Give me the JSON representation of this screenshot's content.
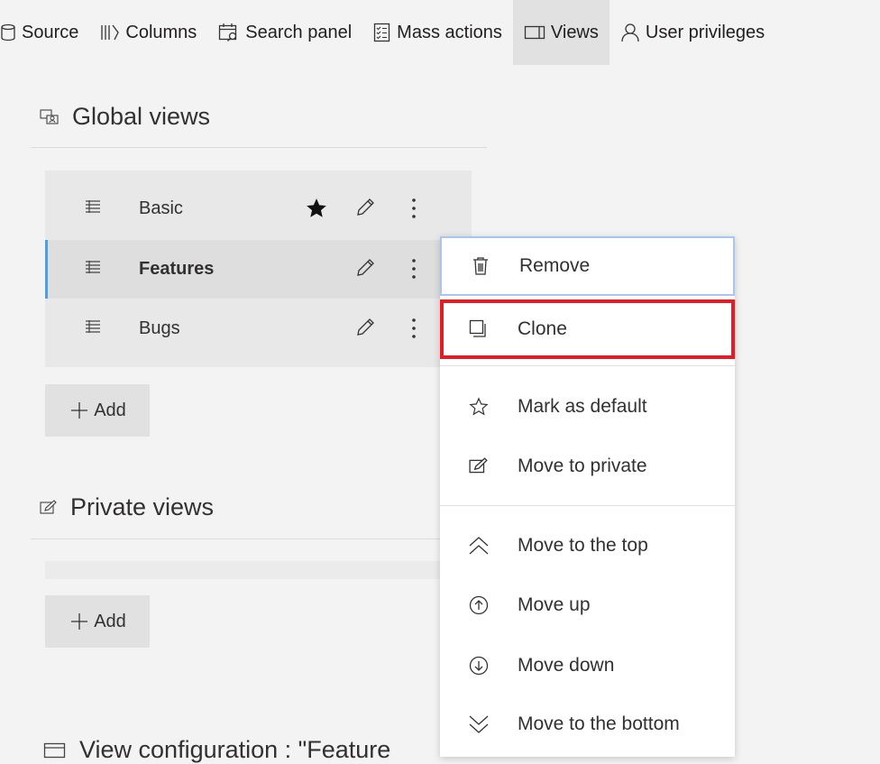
{
  "toolbar": {
    "items": [
      {
        "label": "Source",
        "icon": "database-icon"
      },
      {
        "label": "Columns",
        "icon": "columns-icon"
      },
      {
        "label": "Search panel",
        "icon": "search-panel-icon"
      },
      {
        "label": "Mass actions",
        "icon": "mass-actions-icon"
      },
      {
        "label": "Views",
        "icon": "views-icon",
        "active": true
      },
      {
        "label": "User privileges",
        "icon": "user-icon"
      }
    ]
  },
  "global_views": {
    "title": "Global views",
    "items": [
      {
        "label": "Basic",
        "default": true
      },
      {
        "label": "Features",
        "selected": true
      },
      {
        "label": "Bugs"
      }
    ],
    "add_label": "Add"
  },
  "private_views": {
    "title": "Private views",
    "add_label": "Add"
  },
  "view_configuration": {
    "title": "View configuration : \"Feature"
  },
  "context_menu": {
    "items": [
      {
        "label": "Remove",
        "icon": "trash-icon"
      },
      {
        "label": "Clone",
        "icon": "clone-icon",
        "highlighted": true
      },
      {
        "label": "Mark as default",
        "icon": "star-outline-icon"
      },
      {
        "label": "Move to private",
        "icon": "move-private-icon"
      },
      {
        "label": "Move to the top",
        "icon": "double-chevron-up-icon"
      },
      {
        "label": "Move up",
        "icon": "circle-arrow-up-icon"
      },
      {
        "label": "Move down",
        "icon": "circle-arrow-down-icon"
      },
      {
        "label": "Move to the bottom",
        "icon": "double-chevron-down-icon"
      }
    ]
  },
  "colors": {
    "accent": "#5b9bd5",
    "highlight_border": "#e01e26",
    "background": "#f3f3f3"
  }
}
